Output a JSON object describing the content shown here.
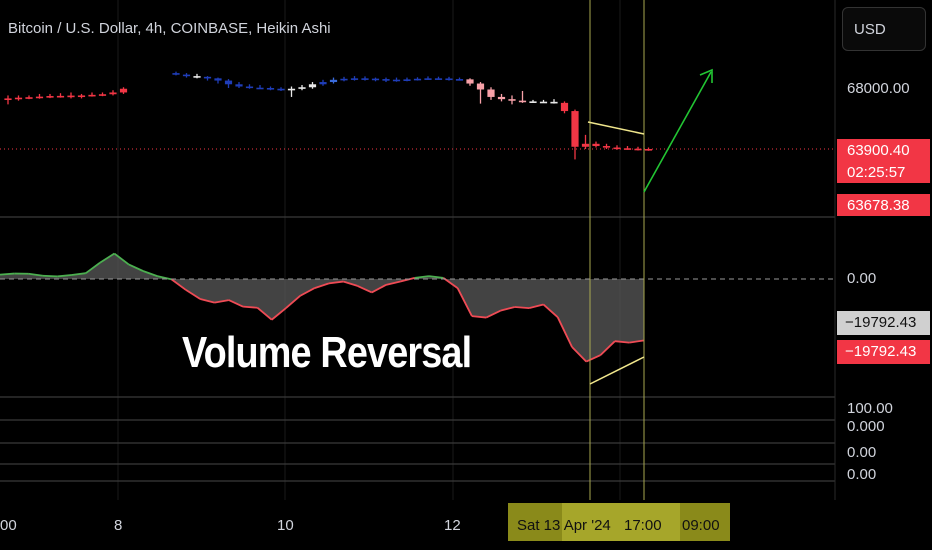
{
  "header": {
    "title": "Bitcoin / U.S. Dollar, 4h, COINBASE, Heikin Ashi",
    "currency_button": "USD"
  },
  "colors": {
    "bear": "#f23645",
    "bear_light": "#f7a1a8",
    "bull_green": "#26d926",
    "blue_dark": "#1f3db8",
    "blue_light": "#3a6bdb",
    "neutral": "#e8e8e8",
    "osc_pos": "#4caf50",
    "osc_neg": "#ef4b55",
    "trend_line": "#f0e68c",
    "arrow": "#22c533",
    "cursor_line": "#a8a850"
  },
  "price_axis": {
    "level_label": "68000.00",
    "last_price": "63900.40",
    "countdown": "02:25:57",
    "low_price": "63678.38"
  },
  "indicator_axis": {
    "zero_label": "0.00",
    "value_grey": "−19792.43",
    "value_red": "−19792.43",
    "scale_labels": [
      "100.00",
      "0.000",
      "0.00",
      "0.00"
    ]
  },
  "annotation": "Volume Reversal",
  "x_axis": {
    "ticks": [
      "00",
      "8",
      "10",
      "12"
    ],
    "cursor_date": "Sat 13 Apr '24",
    "cursor_time": "17:00",
    "next_time": "09:00"
  },
  "chart_data": {
    "type": "candlestick",
    "title": "Bitcoin / U.S. Dollar, 4h, COINBASE, Heikin Ashi",
    "price_scale": {
      "ref_value": 68000,
      "last_value": 63900.4,
      "low_value": 63678.38
    },
    "candles": [
      {
        "o": 67250,
        "c": 67300,
        "h": 67500,
        "l": 66900,
        "color": "bear"
      },
      {
        "o": 67300,
        "c": 67350,
        "h": 67500,
        "l": 67150,
        "color": "bear"
      },
      {
        "o": 67350,
        "c": 67380,
        "h": 67500,
        "l": 67250,
        "color": "bear"
      },
      {
        "o": 67380,
        "c": 67420,
        "h": 67600,
        "l": 67280,
        "color": "bear"
      },
      {
        "o": 67420,
        "c": 67460,
        "h": 67600,
        "l": 67320,
        "color": "bear"
      },
      {
        "o": 67460,
        "c": 67470,
        "h": 67650,
        "l": 67350,
        "color": "bear"
      },
      {
        "o": 67470,
        "c": 67490,
        "h": 67700,
        "l": 67300,
        "color": "bear"
      },
      {
        "o": 67490,
        "c": 67500,
        "h": 67600,
        "l": 67300,
        "color": "bear"
      },
      {
        "o": 67500,
        "c": 67540,
        "h": 67700,
        "l": 67420,
        "color": "bear"
      },
      {
        "o": 67540,
        "c": 67580,
        "h": 67700,
        "l": 67450,
        "color": "bear"
      },
      {
        "o": 67580,
        "c": 67700,
        "h": 67850,
        "l": 67500,
        "color": "bear"
      },
      {
        "o": 67700,
        "c": 67950,
        "h": 68050,
        "l": 67600,
        "color": "bear"
      },
      {
        "o": 67950,
        "c": 68500,
        "h": 68600,
        "l": 67850,
        "color": "green"
      },
      {
        "o": 68500,
        "c": 68750,
        "h": 68900,
        "l": 68400,
        "color": "green"
      },
      {
        "o": 68750,
        "c": 68900,
        "h": 69000,
        "l": 68700,
        "color": "green"
      },
      {
        "o": 68900,
        "c": 69000,
        "h": 69100,
        "l": 68850,
        "color": "green"
      },
      {
        "o": 69000,
        "c": 68900,
        "h": 69100,
        "l": 68850,
        "color": "blue_dark"
      },
      {
        "o": 68900,
        "c": 68800,
        "h": 69000,
        "l": 68700,
        "color": "blue_dark"
      },
      {
        "o": 68800,
        "c": 68750,
        "h": 68950,
        "l": 68650,
        "color": "neutral"
      },
      {
        "o": 68750,
        "c": 68650,
        "h": 68800,
        "l": 68500,
        "color": "blue_dark"
      },
      {
        "o": 68650,
        "c": 68500,
        "h": 68700,
        "l": 68300,
        "color": "blue_dark"
      },
      {
        "o": 68500,
        "c": 68250,
        "h": 68600,
        "l": 68000,
        "color": "blue_dark"
      },
      {
        "o": 68250,
        "c": 68100,
        "h": 68400,
        "l": 68000,
        "color": "blue_dark"
      },
      {
        "o": 68100,
        "c": 68020,
        "h": 68250,
        "l": 67950,
        "color": "blue_dark"
      },
      {
        "o": 68020,
        "c": 68000,
        "h": 68200,
        "l": 67950,
        "color": "blue_dark"
      },
      {
        "o": 68000,
        "c": 67950,
        "h": 68100,
        "l": 67850,
        "color": "blue_dark"
      },
      {
        "o": 67950,
        "c": 67900,
        "h": 68050,
        "l": 67800,
        "color": "blue_dark"
      },
      {
        "o": 67900,
        "c": 67950,
        "h": 68100,
        "l": 67400,
        "color": "neutral"
      },
      {
        "o": 67950,
        "c": 68050,
        "h": 68200,
        "l": 67850,
        "color": "neutral"
      },
      {
        "o": 68050,
        "c": 68250,
        "h": 68400,
        "l": 67950,
        "color": "neutral"
      },
      {
        "o": 68250,
        "c": 68400,
        "h": 68550,
        "l": 68150,
        "color": "blue_dark"
      },
      {
        "o": 68400,
        "c": 68550,
        "h": 68700,
        "l": 68300,
        "color": "blue_light"
      },
      {
        "o": 68550,
        "c": 68620,
        "h": 68750,
        "l": 68450,
        "color": "blue_dark"
      },
      {
        "o": 68620,
        "c": 68650,
        "h": 68800,
        "l": 68500,
        "color": "blue_dark"
      },
      {
        "o": 68650,
        "c": 68630,
        "h": 68780,
        "l": 68500,
        "color": "blue_dark"
      },
      {
        "o": 68630,
        "c": 68600,
        "h": 68700,
        "l": 68450,
        "color": "blue_dark"
      },
      {
        "o": 68600,
        "c": 68560,
        "h": 68700,
        "l": 68400,
        "color": "blue_dark"
      },
      {
        "o": 68560,
        "c": 68550,
        "h": 68700,
        "l": 68420,
        "color": "blue_dark"
      },
      {
        "o": 68550,
        "c": 68580,
        "h": 68700,
        "l": 68450,
        "color": "blue_dark"
      },
      {
        "o": 68580,
        "c": 68620,
        "h": 68720,
        "l": 68500,
        "color": "blue_dark"
      },
      {
        "o": 68620,
        "c": 68650,
        "h": 68780,
        "l": 68550,
        "color": "blue_dark"
      },
      {
        "o": 68650,
        "c": 68640,
        "h": 68760,
        "l": 68550,
        "color": "blue_dark"
      },
      {
        "o": 68640,
        "c": 68600,
        "h": 68750,
        "l": 68500,
        "color": "blue_dark"
      },
      {
        "o": 68600,
        "c": 68580,
        "h": 68700,
        "l": 68500,
        "color": "blue_dark"
      },
      {
        "o": 68580,
        "c": 68300,
        "h": 68650,
        "l": 68150,
        "color": "bear_light"
      },
      {
        "o": 68300,
        "c": 67900,
        "h": 68400,
        "l": 66950,
        "color": "bear_light"
      },
      {
        "o": 67900,
        "c": 67400,
        "h": 68050,
        "l": 67200,
        "color": "bear_light"
      },
      {
        "o": 67400,
        "c": 67250,
        "h": 67600,
        "l": 67100,
        "color": "bear_light"
      },
      {
        "o": 67250,
        "c": 67150,
        "h": 67500,
        "l": 66900,
        "color": "bear_light"
      },
      {
        "o": 67150,
        "c": 67100,
        "h": 67800,
        "l": 67000,
        "color": "bear_light"
      },
      {
        "o": 67100,
        "c": 67080,
        "h": 67200,
        "l": 67000,
        "color": "neutral"
      },
      {
        "o": 67080,
        "c": 67070,
        "h": 67200,
        "l": 67000,
        "color": "neutral"
      },
      {
        "o": 67070,
        "c": 67000,
        "h": 67250,
        "l": 66950,
        "color": "neutral"
      },
      {
        "o": 67000,
        "c": 66450,
        "h": 67100,
        "l": 66300,
        "color": "bear"
      },
      {
        "o": 66450,
        "c": 64050,
        "h": 66550,
        "l": 63200,
        "color": "bear"
      },
      {
        "o": 64050,
        "c": 64250,
        "h": 64850,
        "l": 63900,
        "color": "bear"
      },
      {
        "o": 64250,
        "c": 64100,
        "h": 64400,
        "l": 64000,
        "color": "bear"
      },
      {
        "o": 64100,
        "c": 64000,
        "h": 64250,
        "l": 63900,
        "color": "bear"
      },
      {
        "o": 64000,
        "c": 63950,
        "h": 64150,
        "l": 63850,
        "color": "bear"
      },
      {
        "o": 63950,
        "c": 63920,
        "h": 64100,
        "l": 63850,
        "color": "bear"
      },
      {
        "o": 63920,
        "c": 63900,
        "h": 64050,
        "l": 63800,
        "color": "bear"
      },
      {
        "o": 63900,
        "c": 63870,
        "h": 64000,
        "l": 63780,
        "color": "bear"
      }
    ],
    "oscillator": {
      "name": "",
      "last_value": -19792.43,
      "values": [
        1200,
        1500,
        1450,
        900,
        700,
        1100,
        1600,
        4500,
        7000,
        4000,
        2200,
        800,
        -100,
        -3000,
        -5500,
        -6500,
        -5800,
        -7600,
        -7900,
        -11200,
        -8000,
        -4600,
        -2500,
        -1200,
        -700,
        -1900,
        -3700,
        -1600,
        -700,
        300,
        800,
        300,
        -2500,
        -10200,
        -10600,
        -8700,
        -7700,
        -8000,
        -7000,
        -10500,
        -18700,
        -22700,
        -20900,
        -17100,
        -17500,
        -16900
      ]
    },
    "annotations": [
      "Volume Reversal"
    ]
  }
}
